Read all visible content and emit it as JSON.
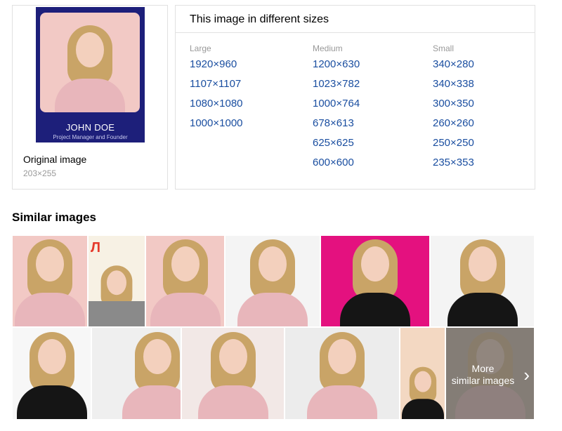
{
  "original": {
    "poster_name": "JOHN DOE",
    "poster_role": "Project Manager and Founder",
    "label": "Original image",
    "size": "203×255"
  },
  "sizes": {
    "title": "This image in different sizes",
    "large": {
      "label": "Large",
      "items": [
        "1920×960",
        "1107×1107",
        "1080×1080",
        "1000×1000"
      ]
    },
    "medium": {
      "label": "Medium",
      "items": [
        "1200×630",
        "1023×782",
        "1000×764",
        "678×613",
        "625×625",
        "600×600"
      ]
    },
    "small": {
      "label": "Small",
      "items": [
        "340×280",
        "340×338",
        "300×350",
        "260×260",
        "250×250",
        "235×353"
      ]
    }
  },
  "similar": {
    "title": "Similar images",
    "more_label_line1": "More",
    "more_label_line2": "similar images",
    "colors": {
      "pink_bg": "#f2c9c5",
      "magenta_bg": "#e4117f",
      "white_bg": "#f4f4f4",
      "hair": "#c9a467",
      "top_pink": "#e8b6bb",
      "top_black": "#151515"
    }
  },
  "icons": {
    "chevron": "chevron-right-icon"
  }
}
